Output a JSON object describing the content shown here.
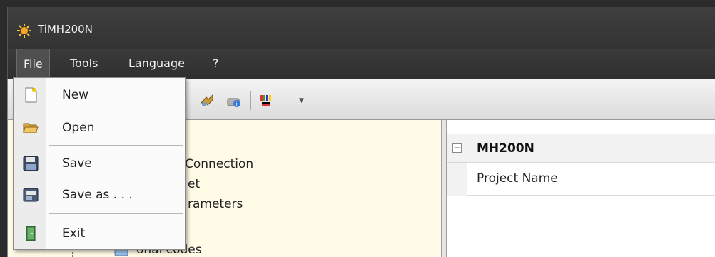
{
  "window": {
    "title": "TiMH200N"
  },
  "menubar": {
    "items": [
      "File",
      "Tools",
      "Language",
      "?"
    ]
  },
  "file_menu": {
    "items": [
      {
        "label": "New",
        "icon": "new-document-icon"
      },
      {
        "label": "Open",
        "icon": "open-folder-icon"
      },
      {
        "label": "Save",
        "icon": "save-disk-icon"
      },
      {
        "label": "Save as . . .",
        "icon": "save-as-icon"
      },
      {
        "label": "Exit",
        "icon": "exit-door-icon"
      }
    ]
  },
  "tree": {
    "items": [
      "Connection",
      "et",
      "rameters",
      "onal codes"
    ]
  },
  "properties": {
    "group": "MH200N",
    "rows": [
      "Project Name"
    ]
  },
  "colors": {
    "title_bar": "#333333",
    "menu_bar": "#303030",
    "tree_background": "#fffbe6",
    "menu_background": "#fbfbfb"
  }
}
